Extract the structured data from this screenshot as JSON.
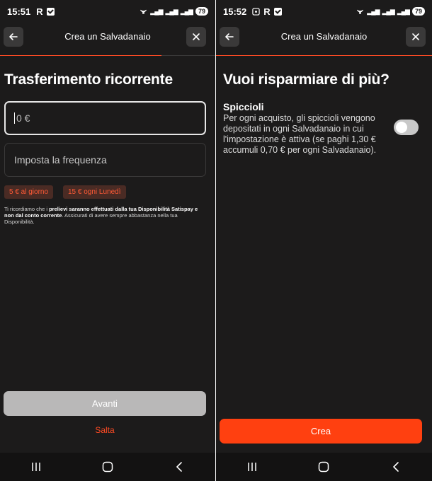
{
  "left_screen": {
    "status": {
      "time": "15:51",
      "carrier": "R",
      "battery": "79"
    },
    "header": {
      "title": "Crea un Salvadanaio"
    },
    "heading": "Trasferimento ricorrente",
    "amount_field": {
      "value": "0 €"
    },
    "frequency_field": {
      "placeholder": "Imposta la frequenza"
    },
    "chips": [
      "5 € al giorno",
      "15 € ogni Lunedì"
    ],
    "note": {
      "part1": "Ti ricordiamo che i ",
      "bold": "prelievi saranno effettuati dalla tua Disponibilità Satispay e non dal conto corrente",
      "part2": ". Assicurati di avere sempre abbastanza nella tua Disponibilità."
    },
    "primary_button": "Avanti",
    "secondary_link": "Salta",
    "progress": 0.75
  },
  "right_screen": {
    "status": {
      "time": "15:52",
      "carrier": "R",
      "battery": "79"
    },
    "header": {
      "title": "Crea un Salvadanaio"
    },
    "heading": "Vuoi risparmiare di più?",
    "option": {
      "title": "Spiccioli",
      "description": "Per ogni acquisto, gli spiccioli vengono depositati in ogni Salvadanaio in cui l'impostazione è attiva (se paghi 1,30 € accumuli 0,70 € per ogni Salvadanaio).",
      "enabled": false
    },
    "primary_button": "Crea",
    "progress": 1.0
  },
  "colors": {
    "accent": "#ff4b24",
    "background": "#1c1b1b",
    "disabled_button": "#b9b8b8"
  }
}
